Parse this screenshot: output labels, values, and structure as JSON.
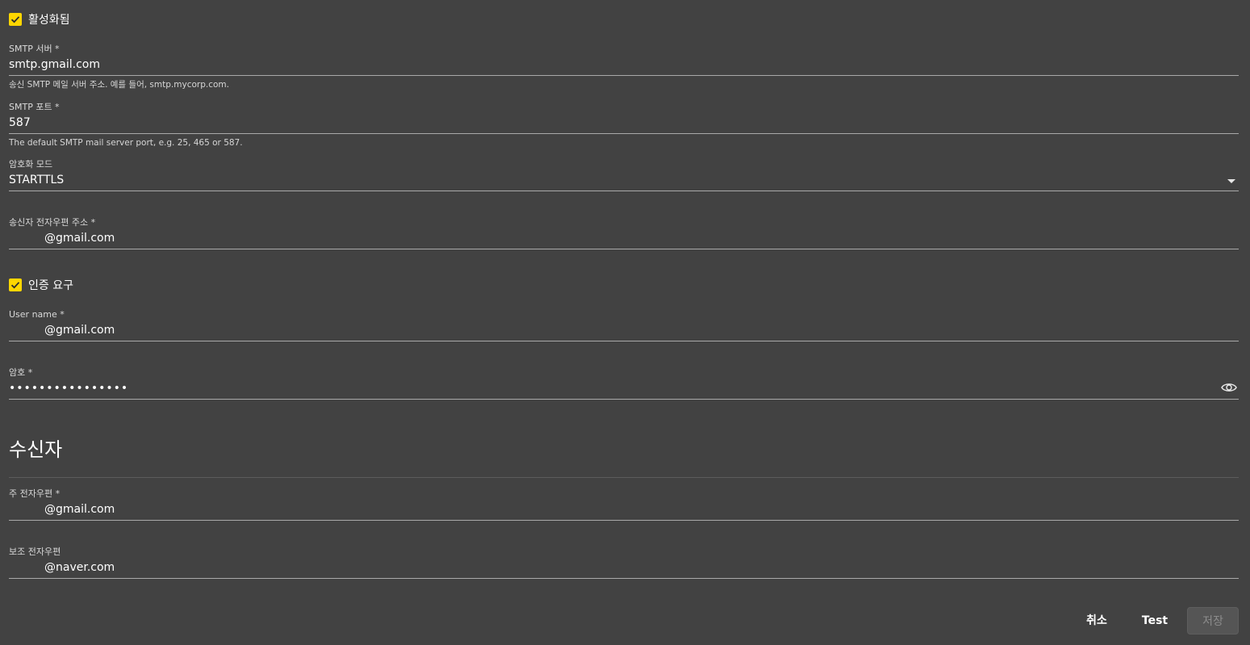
{
  "enabled": {
    "label": "활성화됨",
    "checked": true
  },
  "smtp_server": {
    "label": "SMTP 서버 *",
    "value": "smtp.gmail.com",
    "hint": "송신 SMTP 메일 서버 주소. 예를 들어, smtp.mycorp.com."
  },
  "smtp_port": {
    "label": "SMTP 포트 *",
    "value": "587",
    "hint": "The default SMTP mail server port, e.g. 25, 465 or 587."
  },
  "encryption": {
    "label": "암호화 모드",
    "value": "STARTTLS"
  },
  "sender_email": {
    "label": "송신자 전자우편 주소 *",
    "value": "@gmail.com"
  },
  "auth_required": {
    "label": "인증 요구",
    "checked": true
  },
  "username": {
    "label": "User name *",
    "value": "@gmail.com"
  },
  "password": {
    "label": "암호 *",
    "value": "••••••••••••••••"
  },
  "recipients": {
    "title": "수신자",
    "primary": {
      "label": "주 전자우편 *",
      "value": "@gmail.com"
    },
    "secondary": {
      "label": "보조 전자우편",
      "value": "@naver.com"
    }
  },
  "actions": {
    "cancel": "취소",
    "test": "Test",
    "save": "저장"
  },
  "colors": {
    "background": "#424242",
    "checkbox": "#ffd600",
    "underline": "#a9a9a9"
  }
}
